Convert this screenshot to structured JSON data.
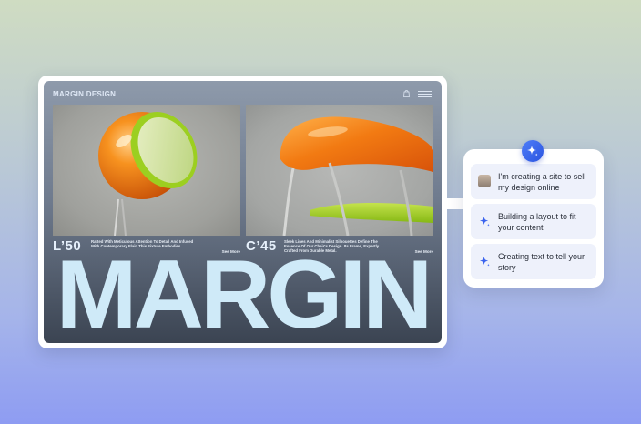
{
  "site": {
    "brand": "MARGIN DESIGN",
    "headline": "MARGIN",
    "products": [
      {
        "code": "L’50",
        "description": "Rafted With Meticulous Attention To Detail And Infused With Contemporary Flair, This Fixture Embodies.",
        "see_more": "See More",
        "image": "orange-globe-lamp"
      },
      {
        "code": "C’45",
        "description": "Sleek Lines And Minimalist Silhouettes Define The Essence Of Our Chair's Design. Its Frame, Expertly Crafted From Durable Metal.",
        "see_more": "See More",
        "image": "orange-shell-chair"
      }
    ],
    "icons": [
      "bag-icon",
      "menu-icon"
    ]
  },
  "assistant": {
    "badge_icon": "sparkle-icon",
    "messages": [
      {
        "icon": "user-avatar",
        "text": "I'm creating a site to sell my design online"
      },
      {
        "icon": "sparkle-icon",
        "text": "Building a layout to fit your content"
      },
      {
        "icon": "sparkle-icon",
        "text": "Creating text to tell your story"
      }
    ]
  },
  "colors": {
    "accent_blue": "#3a63ee",
    "headline": "#cfeaf8",
    "product_orange": "#f07a10",
    "product_green": "#9ccf20"
  }
}
